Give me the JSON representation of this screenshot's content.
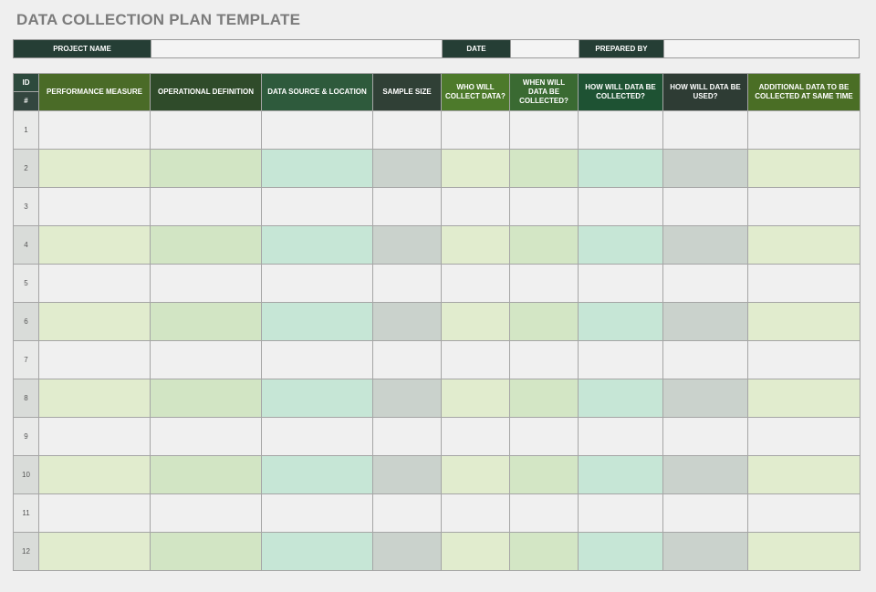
{
  "title": "DATA COLLECTION PLAN TEMPLATE",
  "info_bar": {
    "project_name_label": "PROJECT NAME",
    "project_name_value": "",
    "date_label": "DATE",
    "date_value": "",
    "prepared_by_label": "PREPARED BY",
    "prepared_by_value": ""
  },
  "table": {
    "id_label": "ID",
    "number_label": "#",
    "columns": [
      "PERFORMANCE MEASURE",
      "OPERATIONAL DEFINITION",
      "DATA SOURCE & LOCATION",
      "SAMPLE SIZE",
      "WHO WILL COLLECT DATA?",
      "WHEN WILL DATA BE COLLECTED?",
      "HOW WILL DATA BE COLLECTED?",
      "HOW WILL DATA BE USED?",
      "ADDITIONAL DATA TO BE COLLECTED AT SAME TIME"
    ],
    "rows": [
      "1",
      "2",
      "3",
      "4",
      "5",
      "6",
      "7",
      "8",
      "9",
      "10",
      "11",
      "12"
    ]
  },
  "colors": {
    "header_dark_green": "#253e35",
    "row_band_green": "#e1ecce",
    "row_band_teal": "#c6e6d6",
    "row_band_gray": "#cad2cc"
  }
}
